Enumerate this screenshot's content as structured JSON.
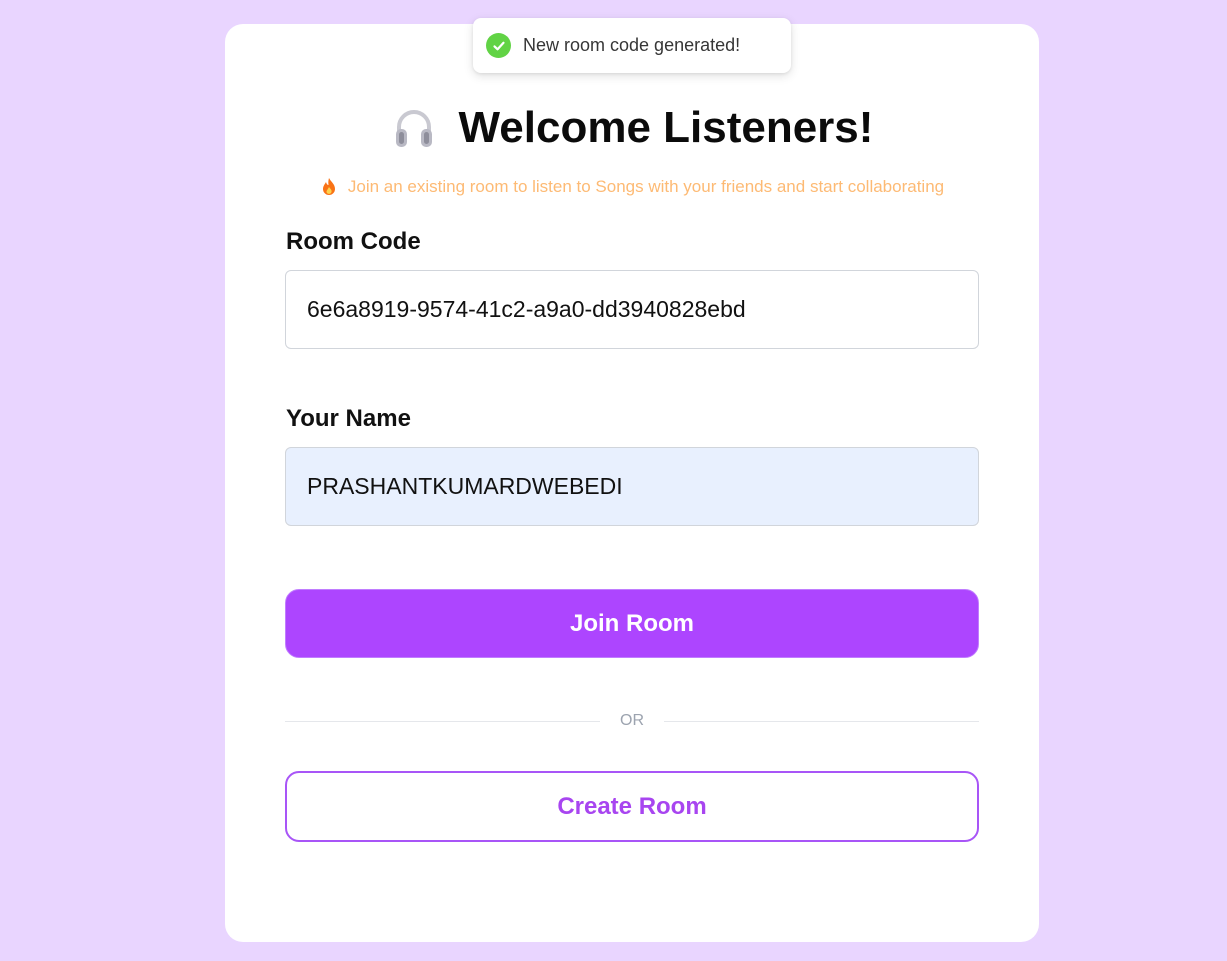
{
  "toast": {
    "message": "New room code generated!",
    "icon": "check-circle-icon",
    "icon_color": "#61d345"
  },
  "header": {
    "icon": "headphones-icon",
    "title": "Welcome Listeners!",
    "subtitle_icon": "fire-icon",
    "subtitle": "Join an existing room to listen to Songs with your friends and start collaborating"
  },
  "form": {
    "room_code_label": "Room Code",
    "room_code_value": "6e6a8919-9574-41c2-a9a0-dd3940828ebd",
    "name_label": "Your Name",
    "name_value": "PRASHANTKUMARDWEBEDI",
    "join_label": "Join Room",
    "divider_text": "OR",
    "create_label": "Create Room"
  },
  "colors": {
    "page_background": "#e9d5ff",
    "accent": "#ad45ff",
    "subtitle": "#fdba74"
  }
}
